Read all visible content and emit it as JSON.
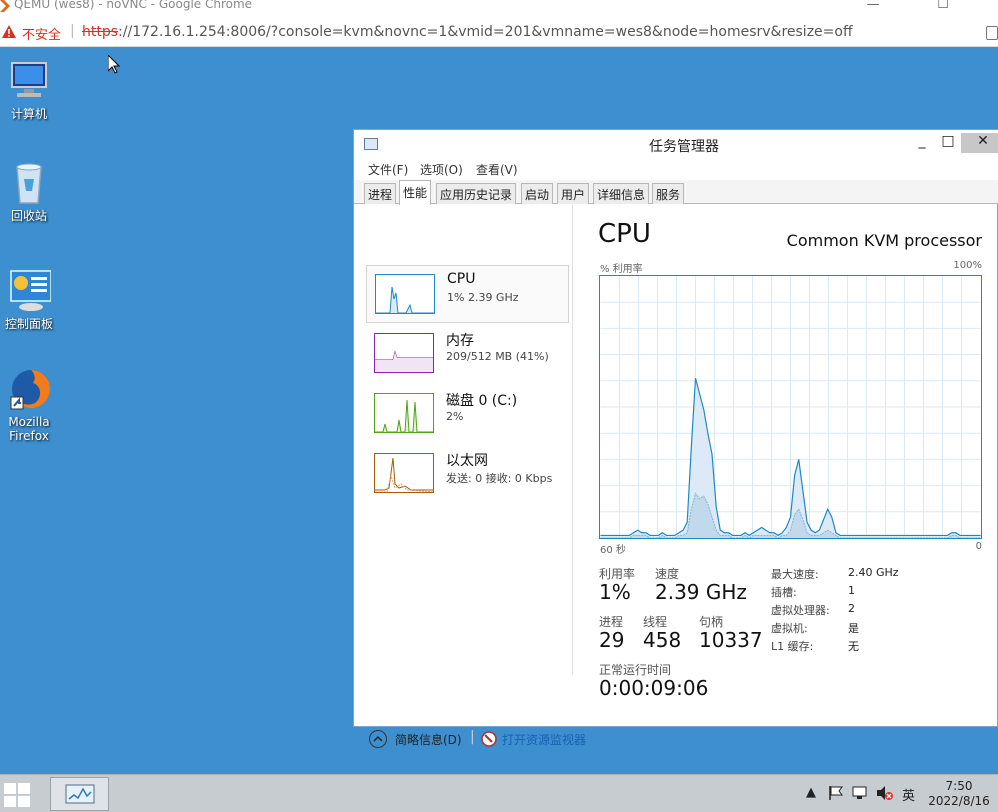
{
  "chrome": {
    "title": "QEMU (wes8) - noVNC - Google Chrome",
    "minimize": "—",
    "maximize": "☐",
    "not_secure": "不安全",
    "url_scheme": "https",
    "url_rest": "://172.16.1.254:8006/?console=kvm&novnc=1&vmid=201&vmname=wes8&node=homesrv&resize=off"
  },
  "desktop": {
    "icons": [
      {
        "label": "计算机"
      },
      {
        "label": "回收站"
      },
      {
        "label": "控制面板"
      },
      {
        "label": "Mozilla Firefox"
      }
    ]
  },
  "taskmanager": {
    "title": "任务管理器",
    "window_buttons": {
      "minimize": "_",
      "maximize": "□",
      "close": "✕"
    },
    "menu": [
      "文件(F)",
      "选项(O)",
      "查看(V)"
    ],
    "tabs": [
      "进程",
      "性能",
      "应用历史记录",
      "启动",
      "用户",
      "详细信息",
      "服务"
    ],
    "active_tab": 1,
    "resources": [
      {
        "name": "CPU",
        "sub": "1% 2.39 GHz",
        "color": "#1e88c7"
      },
      {
        "name": "内存",
        "sub": "209/512 MB (41%)",
        "color": "#8b23a8"
      },
      {
        "name": "磁盘 0 (C:)",
        "sub": "2%",
        "color": "#4da50f"
      },
      {
        "name": "以太网",
        "sub": "发送: 0 接收: 0 Kbps",
        "color": "#a75a0b"
      }
    ],
    "detail": {
      "title": "CPU",
      "processor": "Common KVM processor",
      "y_label": "% 利用率",
      "y_max": "100%",
      "x_left": "60 秒",
      "x_right": "0",
      "stats": {
        "utilization_label": "利用率",
        "utilization": "1%",
        "speed_label": "速度",
        "speed": "2.39 GHz",
        "processes_label": "进程",
        "processes": "29",
        "threads_label": "线程",
        "threads": "458",
        "handles_label": "句柄",
        "handles": "10337",
        "uptime_label": "正常运行时间",
        "uptime": "0:00:09:06"
      },
      "specs": [
        {
          "k": "最大速度:",
          "v": "2.40 GHz"
        },
        {
          "k": "插槽:",
          "v": "1"
        },
        {
          "k": "虚拟处理器:",
          "v": "2"
        },
        {
          "k": "虚拟机:",
          "v": "是"
        },
        {
          "k": "L1 缓存:",
          "v": "无"
        }
      ]
    },
    "footer": {
      "brief": "简略信息(D)",
      "resource_monitor": "打开资源监视器"
    }
  },
  "taskbar": {
    "tray_lang": "英",
    "time": "7:50",
    "date": "2022/8/16"
  },
  "chart_data": {
    "type": "area",
    "title": "CPU",
    "ylabel": "% 利用率",
    "ylim": [
      0,
      100
    ],
    "x_range_seconds": [
      60,
      0
    ],
    "series": [
      {
        "values": [
          1,
          1,
          1,
          1,
          1,
          1,
          1,
          1,
          2,
          3,
          2,
          2,
          1,
          1,
          1,
          2,
          1,
          1,
          1,
          2,
          3,
          6,
          35,
          61,
          55,
          49,
          40,
          32,
          12,
          3,
          2,
          2,
          1,
          1,
          1,
          2,
          1,
          2,
          3,
          4,
          3,
          2,
          2,
          1,
          2,
          4,
          8,
          24,
          30,
          18,
          6,
          3,
          2,
          3,
          7,
          11,
          8,
          2,
          1,
          1,
          1,
          1,
          1,
          1,
          1,
          1,
          1,
          1,
          1,
          1,
          1,
          1,
          1,
          1,
          1,
          1,
          1,
          1,
          1,
          1,
          1,
          1,
          1,
          1,
          1,
          2,
          2,
          1,
          1,
          1,
          1,
          1,
          1
        ]
      },
      {
        "values": [
          0,
          0,
          0,
          0,
          0,
          0,
          0,
          0,
          1,
          1,
          1,
          1,
          0,
          0,
          0,
          1,
          0,
          0,
          0,
          1,
          1,
          2,
          11,
          17,
          15,
          16,
          13,
          8,
          3,
          1,
          1,
          1,
          0,
          0,
          0,
          1,
          0,
          1,
          1,
          1,
          1,
          1,
          1,
          0,
          1,
          1,
          3,
          9,
          11,
          7,
          2,
          1,
          1,
          1,
          2,
          3,
          2,
          1,
          0,
          0,
          0,
          0,
          0,
          0,
          0,
          0,
          0,
          0,
          0,
          0,
          0,
          0,
          0,
          0,
          0,
          0,
          0,
          0,
          0,
          0,
          0,
          0,
          0,
          0,
          0,
          1,
          1,
          0,
          0,
          0,
          0,
          0,
          0
        ]
      }
    ]
  }
}
